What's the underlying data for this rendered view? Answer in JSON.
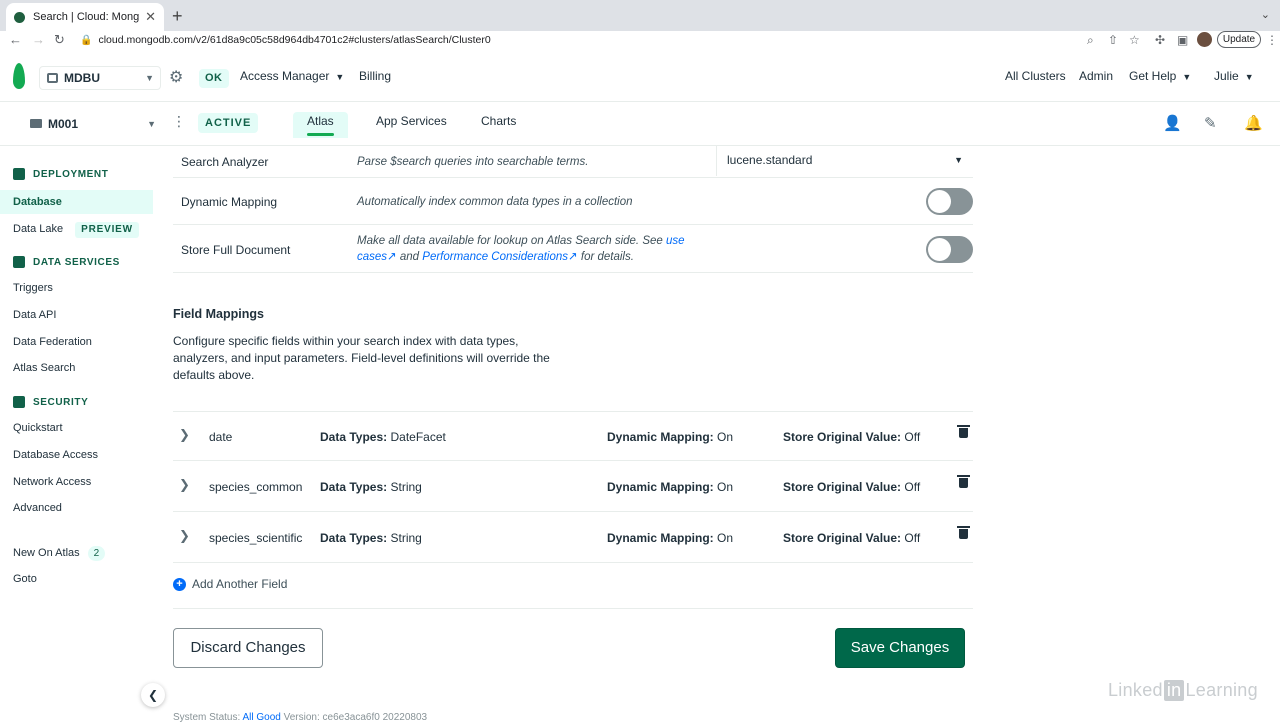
{
  "browser": {
    "tab_title": "Search | Cloud: MongoDB Clo",
    "url": "cloud.mongodb.com/v2/61d8a9c05c58d964db4701c2#clusters/atlasSearch/Cluster0",
    "update_label": "Update"
  },
  "topnav": {
    "org": "MDBU",
    "ok_badge": "OK",
    "access_manager": "Access Manager",
    "billing": "Billing",
    "all_clusters": "All Clusters",
    "admin": "Admin",
    "get_help": "Get Help",
    "user": "Julie"
  },
  "projnav": {
    "project": "M001",
    "status_badge": "ACTIVE",
    "tabs": [
      "Atlas",
      "App Services",
      "Charts"
    ]
  },
  "sidebar": {
    "deployment_head": "DEPLOYMENT",
    "database": "Database",
    "data_lake": "Data Lake",
    "preview_badge": "PREVIEW",
    "data_services_head": "DATA SERVICES",
    "triggers": "Triggers",
    "data_api": "Data API",
    "data_federation": "Data Federation",
    "atlas_search": "Atlas Search",
    "security_head": "SECURITY",
    "quickstart": "Quickstart",
    "database_access": "Database Access",
    "network_access": "Network Access",
    "advanced": "Advanced",
    "new_on_atlas": "New On Atlas",
    "new_on_atlas_count": "2",
    "goto": "Goto"
  },
  "settings": {
    "search_analyzer_label": "Search Analyzer",
    "search_analyzer_desc": "Parse $search queries into searchable terms.",
    "search_analyzer_value": "lucene.standard",
    "dynamic_mapping_label": "Dynamic Mapping",
    "dynamic_mapping_desc": "Automatically index common data types in a collection",
    "store_full_label": "Store Full Document",
    "store_full_desc": "Make all data available for lookup on Atlas Search side. See",
    "store_full_link1": "use cases",
    "store_full_and": "and",
    "store_full_link2": "Performance Considerations",
    "store_full_tail": "for details."
  },
  "field_mappings": {
    "title": "Field Mappings",
    "description": "Configure specific fields within your search index with data types, analyzers, and input parameters. Field-level definitions will override the defaults above.",
    "data_types_label": "Data Types:",
    "dynamic_mapping_label": "Dynamic Mapping:",
    "store_original_label": "Store Original Value:",
    "rows": [
      {
        "name": "date",
        "data_types": "DateFacet",
        "dynamic_mapping": "On",
        "store_original": "Off"
      },
      {
        "name": "species_common",
        "data_types": "String",
        "dynamic_mapping": "On",
        "store_original": "Off"
      },
      {
        "name": "species_scientific",
        "data_types": "String",
        "dynamic_mapping": "On",
        "store_original": "Off"
      }
    ],
    "add_field": "Add Another Field"
  },
  "actions": {
    "discard": "Discard Changes",
    "save": "Save Changes"
  },
  "footer": {
    "status_label": "System Status:",
    "status_value": "All Good",
    "version": "Version: ce6e3aca6f0 20220803"
  },
  "watermark": {
    "pre": "Linked",
    "in": "in",
    "post": "Learning"
  },
  "colors": {
    "brand_green": "#13aa52",
    "dark_green": "#00684a",
    "badge_bg": "#e3fcf7",
    "link_blue": "#016bf8"
  },
  "icons": [
    "mongodb-leaf-icon",
    "gear-icon",
    "folder-icon",
    "kebab-icon",
    "invite-user-icon",
    "activity-icon",
    "bell-icon",
    "trash-icon",
    "chevron-right-icon",
    "plus-circle-icon",
    "external-link-icon"
  ]
}
